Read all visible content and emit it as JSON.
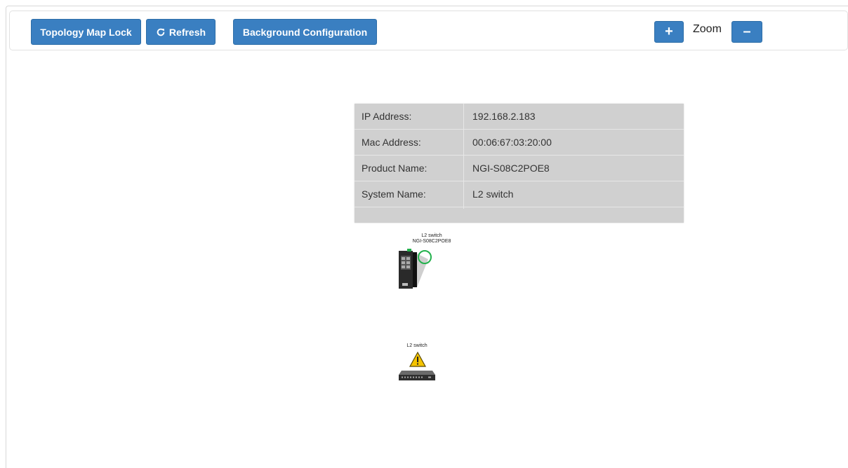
{
  "toolbar": {
    "map_lock_label": "Topology Map Lock",
    "refresh_label": "Refresh",
    "background_config_label": "Background Configuration",
    "zoom_label": "Zoom",
    "zoom_in_symbol": "+",
    "zoom_out_symbol": "–"
  },
  "device_info": {
    "rows": [
      {
        "key": "IP Address:",
        "value": "192.168.2.183"
      },
      {
        "key": "Mac Address:",
        "value": "00:06:67:03:20:00"
      },
      {
        "key": "Product Name:",
        "value": "NGI-S08C2POE8"
      },
      {
        "key": "System Name:",
        "value": "L2 switch"
      }
    ]
  },
  "nodes": [
    {
      "system_name": "L2 switch",
      "product_name": "NGI-S08C2POE8",
      "status": "online",
      "icon": "industrial-switch-icon"
    },
    {
      "system_name": "L2 switch",
      "status": "warning",
      "icon": "desktop-switch-icon"
    }
  ],
  "colors": {
    "button_blue": "#3a7fc1",
    "status_online": "#22b14c",
    "status_warning": "#f5c400"
  }
}
